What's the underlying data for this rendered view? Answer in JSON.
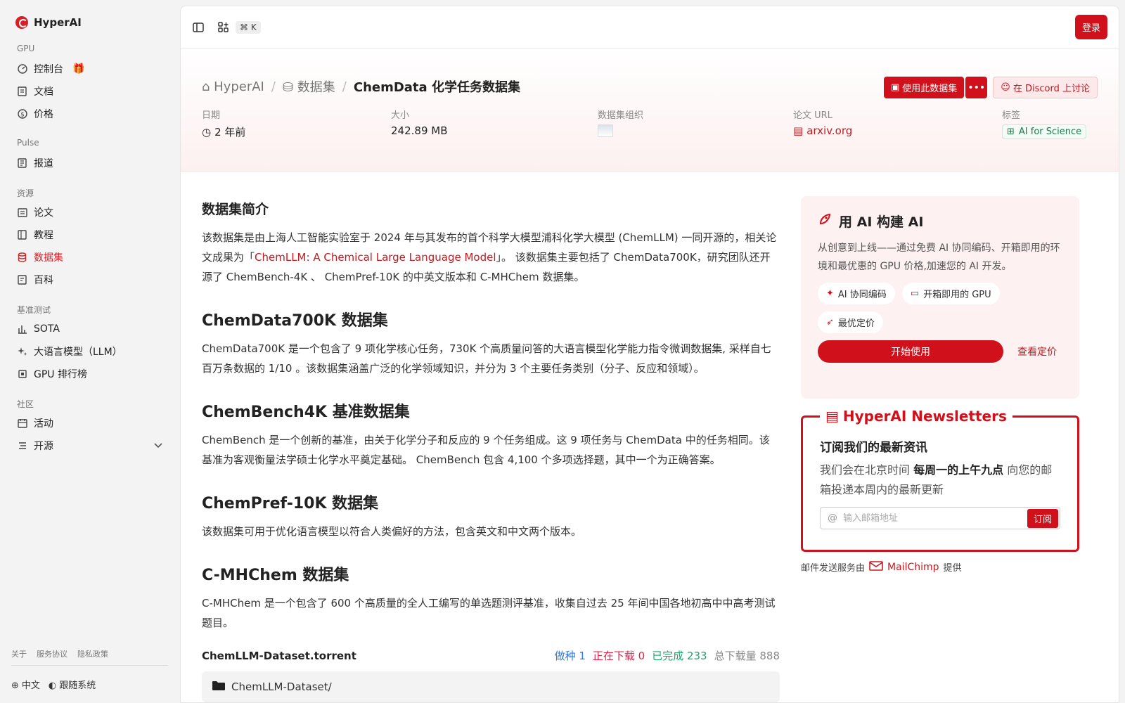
{
  "brand": {
    "name": "HyperAI"
  },
  "sidebar": {
    "sections": [
      {
        "label": "GPU",
        "items": [
          {
            "label": "控制台",
            "icon": "gauge-icon"
          },
          {
            "label": "文档",
            "icon": "doc-icon"
          },
          {
            "label": "价格",
            "icon": "dollar-icon"
          }
        ]
      },
      {
        "label": "Pulse",
        "items": [
          {
            "label": "报道",
            "icon": "news-icon"
          }
        ]
      },
      {
        "label": "资源",
        "items": [
          {
            "label": "论文",
            "icon": "paper-icon"
          },
          {
            "label": "教程",
            "icon": "book-icon"
          },
          {
            "label": "数据集",
            "icon": "database-icon",
            "active": true
          },
          {
            "label": "百科",
            "icon": "wiki-icon"
          }
        ]
      },
      {
        "label": "基准测试",
        "items": [
          {
            "label": "SOTA",
            "icon": "chart-icon"
          },
          {
            "label": "大语言模型（LLM）",
            "icon": "sparkle-icon"
          },
          {
            "label": "GPU 排行榜",
            "icon": "chip-icon"
          }
        ]
      },
      {
        "label": "社区",
        "items": [
          {
            "label": "活动",
            "icon": "calendar-icon"
          },
          {
            "label": "开源",
            "icon": "list-icon"
          }
        ]
      }
    ],
    "footer_links": [
      "关于",
      "服务协议",
      "隐私政策"
    ],
    "language": "中文",
    "theme": "跟随系统"
  },
  "topbar": {
    "kbd": "⌘ K",
    "login": "登录"
  },
  "header": {
    "crumb_home": "HyperAI",
    "crumb_section": "数据集",
    "crumb_current": "ChemData 化学任务数据集",
    "use_dataset": "使用此数据集",
    "discord": "在 Discord 上讨论",
    "meta": {
      "date_label": "日期",
      "date_value": "2 年前",
      "size_label": "大小",
      "size_value": "242.89 MB",
      "org_label": "数据集组织",
      "paper_label": "论文 URL",
      "paper_value": "arxiv.org",
      "tags_label": "标签",
      "tag_value": "AI for Science"
    }
  },
  "content": {
    "intro_title": "数据集简介",
    "intro_p1_a": "该数据集是由上海人工智能实验室于 2024 年与其发布的首个科学大模型浦科化学大模型 (ChemLLM) 一同开源的，相关论文成果为「",
    "intro_link": "ChemLLM: A Chemical Large Language Model",
    "intro_p1_b": "」。 该数据集主要包括了 ChemData700K，研究团队还开源了 ChemBench-4K 、 ChemPref-10K 的中英文版本和 C-MHChem 数据集。",
    "s1_title": "ChemData700K 数据集",
    "s1_text": "ChemData700K 是一个包含了 9 项化学核心任务，730K 个高质量问答的大语言模型化学能力指令微调数据集, 采样自七百万条数据的 1/10 。该数据集涵盖广泛的化学领域知识，并分为 3 个主要任务类别（分子、反应和领域）。",
    "s2_title": "ChemBench4K 基准数据集",
    "s2_text": "ChemBench 是一个创新的基准，由关于化学分子和反应的 9 个任务组成。这 9 项任务与 ChemData 中的任务相同。该基准为客观衡量法学硕士化学水平奠定基础。 ChemBench 包含 4,100 个多项选择题，其中一个为正确答案。",
    "s3_title": "ChemPref-10K 数据集",
    "s3_text": "该数据集可用于优化语言模型以符合人类偏好的方法，包含英文和中文两个版本。",
    "s4_title": "C-MHChem 数据集",
    "s4_text": "C-MHChem 是一个包含了 600 个高质量的全人工编写的单选题测评基准，收集自过去 25 年间中国各地初高中中高考测试题目。"
  },
  "torrent": {
    "name": "ChemLLM-Dataset.torrent",
    "seeding": "做种 1",
    "downloading": "正在下载 0",
    "completed": "已完成 233",
    "total": "总下载量 888",
    "folder": "ChemLLM-Dataset/"
  },
  "aside": {
    "build_title": "用 AI 构建 AI",
    "build_desc": "从创意到上线——通过免费 AI 协同编码、开箱即用的环境和最优惠的 GPU 价格,加速您的 AI 开发。",
    "pill1": "AI 协同编码",
    "pill2": "开箱即用的 GPU",
    "pill3": "最优定价",
    "start": "开始使用",
    "price": "查看定价",
    "news_title": "HyperAI Newsletters",
    "news_heading": "订阅我们的最新资讯",
    "news_p_a": "我们会在北京时间 ",
    "news_p_b": "每周一的上午九点",
    "news_p_c": " 向您的邮箱投递本周内的最新更新",
    "email_placeholder": "输入邮箱地址",
    "subscribe": "订阅",
    "mail_note_a": "邮件发送服务由",
    "mail_note_b": "MailChimp",
    "mail_note_c": "提供"
  }
}
